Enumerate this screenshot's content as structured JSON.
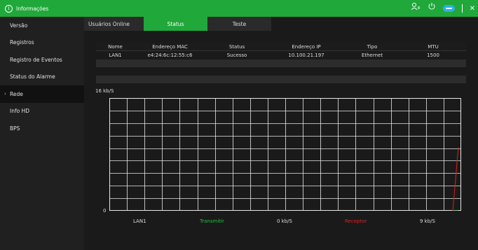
{
  "window": {
    "title": "Informações",
    "info_glyph": "i"
  },
  "toolbar_icons": [
    "user-switch-icon",
    "power-icon",
    "cloud-icon",
    "close-icon"
  ],
  "sidebar": {
    "items": [
      {
        "label": "Versão",
        "active": false
      },
      {
        "label": "Registros",
        "active": false
      },
      {
        "label": "Registro de Eventos",
        "active": false
      },
      {
        "label": "Status do Alarme",
        "active": false
      },
      {
        "label": "Rede",
        "active": true
      },
      {
        "label": "Info HD",
        "active": false
      },
      {
        "label": "BPS",
        "active": false
      }
    ],
    "chevron": "›"
  },
  "tabs": [
    {
      "label": "Usuários Online",
      "active": false
    },
    {
      "label": "Status",
      "active": true
    },
    {
      "label": "Teste",
      "active": false
    }
  ],
  "network_table": {
    "headers": [
      "Nome",
      "Endereço MAC",
      "Status",
      "Endereço IP",
      "Tipo",
      "MTU"
    ],
    "rows": [
      [
        "LAN1",
        "e4:24:6c:12:55:c6",
        "Sucesso",
        "10.100.21.197",
        "Ethernet",
        "1500"
      ]
    ]
  },
  "chart": {
    "y_max_label": "16 kb/S",
    "y_min_label": "0",
    "grid_rows": 9,
    "grid_cols": 20
  },
  "chart_data": {
    "type": "line",
    "title": "",
    "ylim": [
      0,
      16
    ],
    "ylabel": "kb/S",
    "series": [
      {
        "name": "Transmitir",
        "color": "#20c040",
        "values": [
          0,
          0
        ]
      },
      {
        "name": "Receptor",
        "color": "#e02020",
        "values": [
          0,
          9
        ]
      }
    ]
  },
  "legend": {
    "interface": "LAN1",
    "tx_label": "Transmitir",
    "tx_value": "0 kb/S",
    "rx_label": "Receptor",
    "rx_value": "9 kb/S",
    "tx_color": "#20c040",
    "rx_color": "#e02020"
  },
  "colors": {
    "accent": "#20a83a"
  }
}
